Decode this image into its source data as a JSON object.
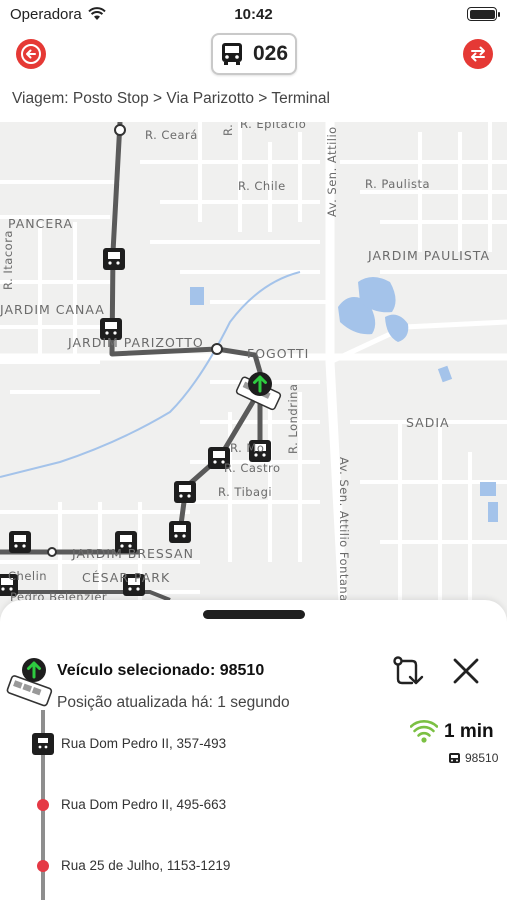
{
  "status_bar": {
    "carrier": "Operadora",
    "time": "10:42"
  },
  "header": {
    "line_number": "026",
    "back_icon": "arrow-left-circle-icon",
    "swap_icon": "swap-direction-icon"
  },
  "trip": {
    "breadcrumb": "Viagem: Posto Stop > Via Parizotto > Terminal"
  },
  "map": {
    "neighborhoods": [
      "PANCERA",
      "JARDIM CANAA",
      "JARDIM PARIZOTTO",
      "FOGOTTI",
      "JARDIM PAULISTA",
      "SADIA",
      "JARDIM BRESSAN",
      "CÉSAR PARK"
    ],
    "streets": [
      "R. Ceará",
      "R. Epitácio",
      "R. Luis S",
      "R. Chile",
      "R. Paulista",
      "Av. Sen. Attilio",
      "Av. Sen. Attilio Fontana",
      "R. Itacora",
      "R. Londrina",
      "R. Tibagi",
      "R. Castro",
      "R. Mo",
      "Chelin",
      "Pedro Belenzier"
    ],
    "route_color": "#5a5a5a",
    "water_color": "#a4c3ea"
  },
  "sheet": {
    "selected_vehicle": "Veículo selecionado: 98510",
    "position_updated": "Posição atualizada há: 1 segundo",
    "stops": [
      {
        "name": "Rua Dom Pedro II, 357-493"
      },
      {
        "name": "Rua Dom Pedro II, 495-663"
      },
      {
        "name": "Rua 25 de Julho, 1153-1219"
      }
    ],
    "eta": {
      "time": "1 min",
      "vehicle": "98510",
      "signal_color": "#7bc043"
    },
    "accent_red": "#e53935"
  }
}
